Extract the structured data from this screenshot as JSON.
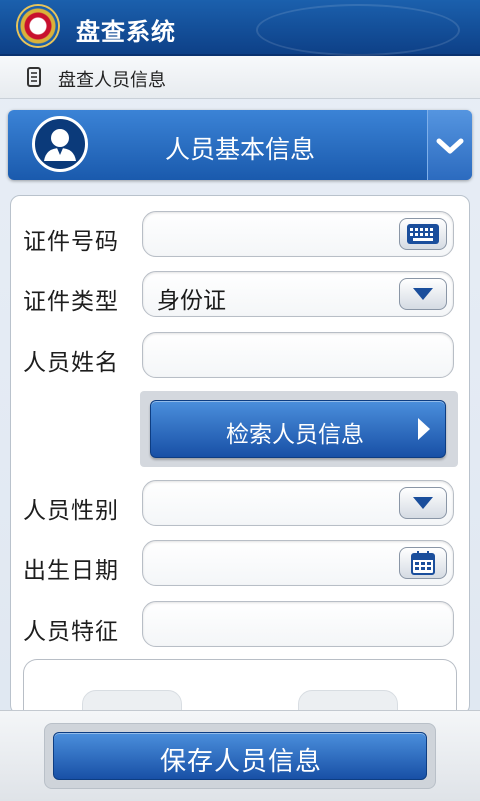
{
  "app": {
    "title": "盘查系统"
  },
  "breadcrumb": {
    "text": "盘查人员信息"
  },
  "section": {
    "title": "人员基本信息"
  },
  "form": {
    "id_number_label": "证件号码",
    "id_number_value": "",
    "id_type_label": "证件类型",
    "id_type_value": "身份证",
    "name_label": "人员姓名",
    "name_value": "",
    "search_label": "检索人员信息",
    "gender_label": "人员性别",
    "gender_value": "",
    "birth_label": "出生日期",
    "birth_value": "",
    "features_label": "人员特征",
    "features_value": ""
  },
  "footer": {
    "save_label": "保存人员信息"
  },
  "colors": {
    "primary": "#1a5aad",
    "title_bar": "#0d3f86"
  },
  "icons": [
    "police-emblem-icon",
    "document-icon",
    "user-avatar-icon",
    "chevron-down-icon",
    "keyboard-icon",
    "dropdown-arrow-icon",
    "calendar-icon",
    "play-arrow-icon"
  ]
}
